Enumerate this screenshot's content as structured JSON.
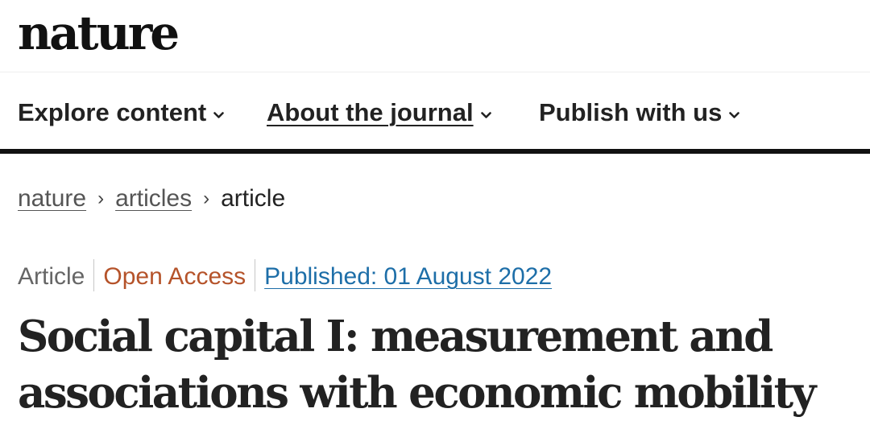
{
  "header": {
    "logo_text": "nature"
  },
  "nav": {
    "items": [
      {
        "label": "Explore content"
      },
      {
        "label": "About the journal"
      },
      {
        "label": "Publish with us"
      }
    ]
  },
  "breadcrumb": {
    "items": [
      {
        "label": "nature"
      },
      {
        "label": "articles"
      },
      {
        "label": "article"
      }
    ],
    "separator": "›"
  },
  "article": {
    "type": "Article",
    "access": "Open Access",
    "published": "Published: 01 August 2022",
    "title": "Social capital I: measurement and associations with economic mobility"
  },
  "colors": {
    "open_access": "#b5532a",
    "link": "#1d6ea8",
    "text": "#222222"
  },
  "icons": {
    "nav_chevron": "chevron-down-icon",
    "breadcrumb_separator": "chevron-right-icon"
  }
}
